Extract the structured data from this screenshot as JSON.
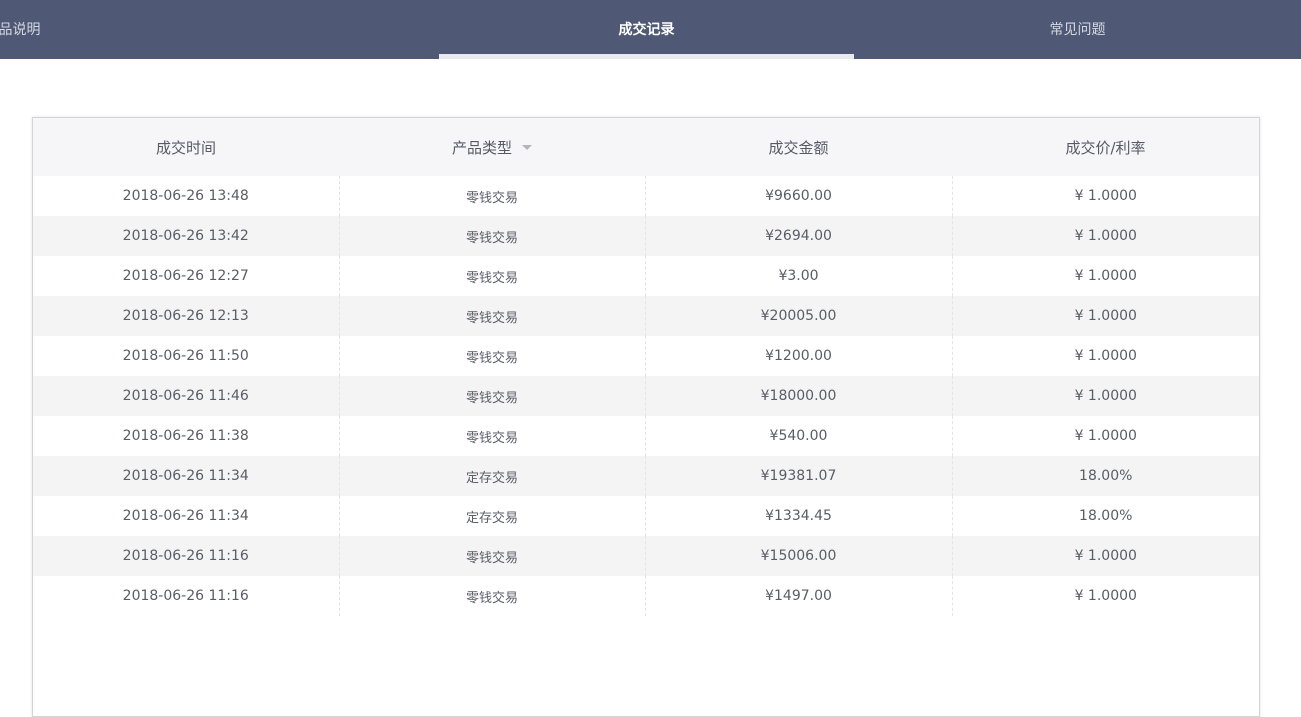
{
  "tabs": [
    {
      "label": "产品说明"
    },
    {
      "label": "成交记录"
    },
    {
      "label": "常见问题"
    }
  ],
  "table": {
    "headers": [
      "成交时间",
      "产品类型",
      "成交金额",
      "成交价/利率"
    ],
    "rows": [
      {
        "time": "2018-06-26 13:48",
        "type": "零钱交易",
        "amount": "¥9660.00",
        "rate": "¥ 1.0000"
      },
      {
        "time": "2018-06-26 13:42",
        "type": "零钱交易",
        "amount": "¥2694.00",
        "rate": "¥ 1.0000"
      },
      {
        "time": "2018-06-26 12:27",
        "type": "零钱交易",
        "amount": "¥3.00",
        "rate": "¥ 1.0000"
      },
      {
        "time": "2018-06-26 12:13",
        "type": "零钱交易",
        "amount": "¥20005.00",
        "rate": "¥ 1.0000"
      },
      {
        "time": "2018-06-26 11:50",
        "type": "零钱交易",
        "amount": "¥1200.00",
        "rate": "¥ 1.0000"
      },
      {
        "time": "2018-06-26 11:46",
        "type": "零钱交易",
        "amount": "¥18000.00",
        "rate": "¥ 1.0000"
      },
      {
        "time": "2018-06-26 11:38",
        "type": "零钱交易",
        "amount": "¥540.00",
        "rate": "¥ 1.0000"
      },
      {
        "time": "2018-06-26 11:34",
        "type": "定存交易",
        "amount": "¥19381.07",
        "rate": "18.00%"
      },
      {
        "time": "2018-06-26 11:34",
        "type": "定存交易",
        "amount": "¥1334.45",
        "rate": "18.00%"
      },
      {
        "time": "2018-06-26 11:16",
        "type": "零钱交易",
        "amount": "¥15006.00",
        "rate": "¥ 1.0000"
      },
      {
        "time": "2018-06-26 11:16",
        "type": "零钱交易",
        "amount": "¥1497.00",
        "rate": "¥ 1.0000"
      }
    ]
  }
}
